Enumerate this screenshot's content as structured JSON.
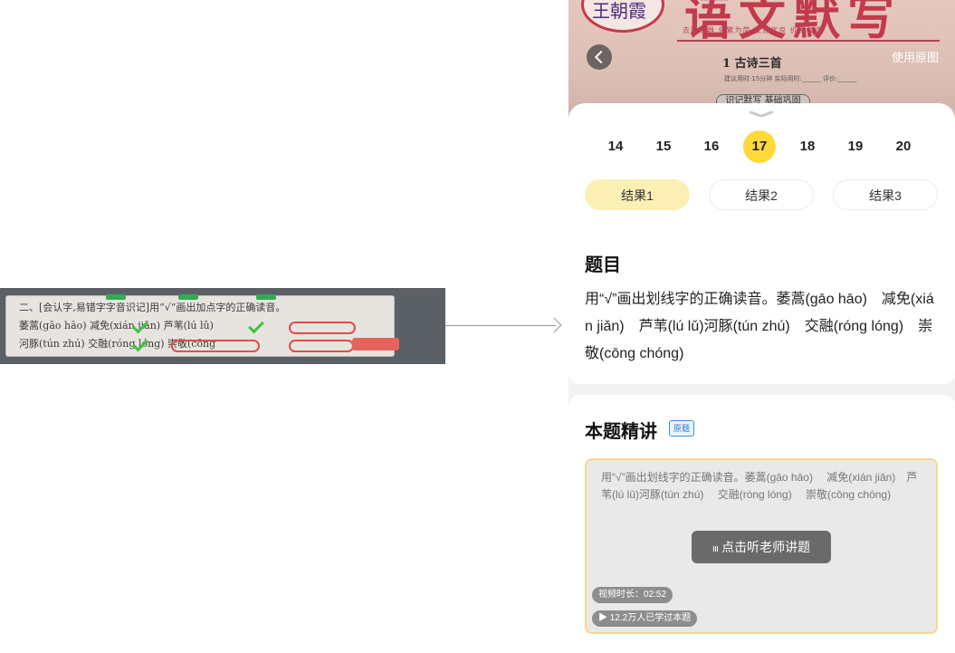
{
  "left_crop": {
    "heading": "二、[会认字,易错字字音识记]用“√”画出加点字的正确读音。",
    "row1": "萎蒿(gāo hāo)   减免(xián jiǎn)   芦苇(lú lǔ)",
    "row2": "河豚(tún zhú)   交融(róng lóng)   崇敬(cōng"
  },
  "photo": {
    "big_title": "语文默写",
    "logo_text": "王朝霞",
    "slogan": "去除利器 化繁为简 反思优良 价格公道",
    "lesson": "1 古诗三首",
    "lesson_meta": "建议用时:15分钟  实际用时:______  评价:______",
    "chip": "识记默写 基础巩固"
  },
  "header": {
    "use_original_label": "使用原图"
  },
  "question_numbers": [
    "14",
    "15",
    "16",
    "17",
    "18",
    "19",
    "20"
  ],
  "active_number": "17",
  "results": [
    "结果1",
    "结果2",
    "结果3"
  ],
  "question": {
    "title": "题目",
    "text": "用“√”画出划线字的正确读音。萎蒿(gāo hāo)　减免(xián jiǎn)　芦苇(lú lǔ)河豚(tún zhú)　交融(róng lóng)　崇敬(cōng chóng)"
  },
  "explanation": {
    "title": "本题精讲",
    "badge": "原题",
    "preview_text": "用“√”画出划线字的正确读音。萎蒿(gāo hāo)　 减免(xián jiǎn)　芦苇(lú lǔ)河豚(tún zhú)　 交融(róng lóng)　 崇敬(cōng chóng)",
    "play_label": "点击听老师讲题",
    "duration": "视频时长：02:52",
    "learners": "▶ 12.2万人已学过本题"
  }
}
